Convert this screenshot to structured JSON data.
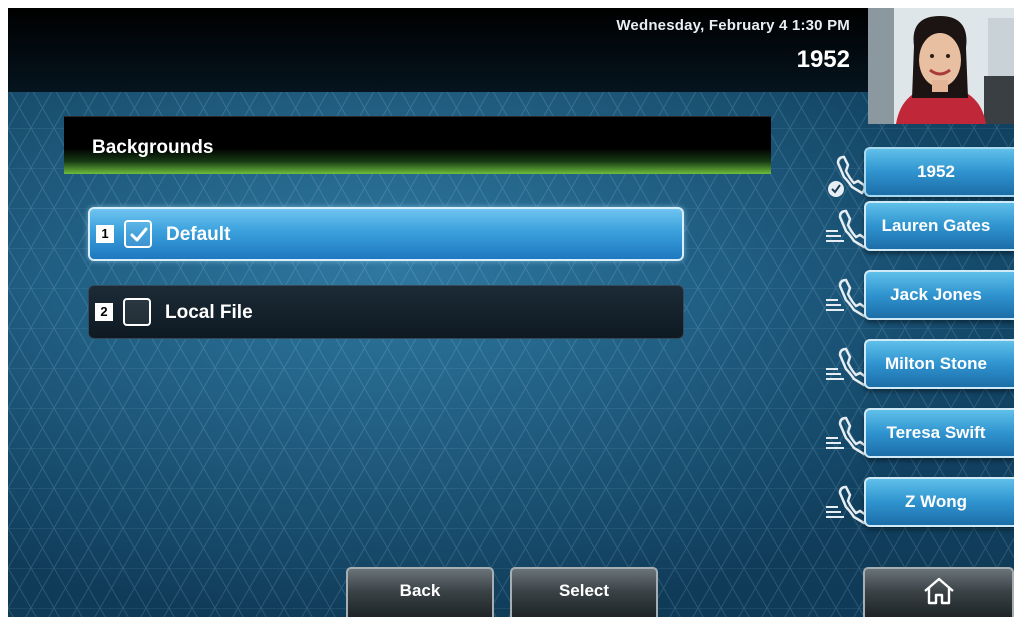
{
  "status": {
    "datetime": "Wednesday, February 4  1:30 PM",
    "line_number": "1952"
  },
  "title": "Backgrounds",
  "list": [
    {
      "number": "1",
      "label": "Default",
      "checked": true,
      "selected": true
    },
    {
      "number": "2",
      "label": "Local File",
      "checked": false,
      "selected": false
    }
  ],
  "lines": [
    {
      "label": "1952",
      "icon": "phone-registered-icon"
    },
    {
      "label": "Lauren Gates",
      "icon": "phone-line-icon"
    },
    {
      "label": "Jack Jones",
      "icon": "phone-line-icon"
    },
    {
      "label": "Milton Stone",
      "icon": "phone-line-icon"
    },
    {
      "label": "Teresa Swift",
      "icon": "phone-line-icon"
    },
    {
      "label": "Z Wong",
      "icon": "phone-line-icon"
    }
  ],
  "softkeys": {
    "back": "Back",
    "select": "Select",
    "home_icon": "home-icon"
  },
  "colors": {
    "selected_item": "#3aa0dc",
    "line_key": "#2f93cf",
    "title_accent": "#6dbd3c"
  }
}
